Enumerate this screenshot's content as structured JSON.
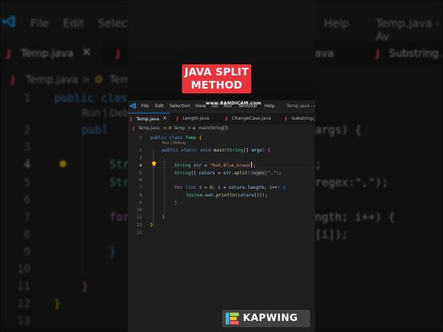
{
  "overlay": {
    "title_line1": "JAVA SPLIT",
    "title_line2": "METHOD",
    "bandicam": "www.BANDICAM.com",
    "watermark": "KAPWING",
    "title_color": "#e8333a"
  },
  "background": {
    "menu": [
      "File",
      "Edit",
      "Select",
      "Help"
    ],
    "window_title": "Temp.java - Av",
    "tabs": [
      "Temp.java",
      "ava",
      "Substring."
    ],
    "breadcrumb": [
      "Temp.java",
      "Tem"
    ],
    "line_numbers": [
      "1",
      "2",
      "3",
      "4",
      "5",
      "6",
      "7",
      "8",
      "9",
      "10",
      "11",
      "12",
      "13"
    ],
    "code_left": [
      "public clas",
      "Run | Deb",
      "publ",
      "Str",
      "Str",
      "for",
      "}",
      "}",
      "}"
    ],
    "code_right": [
      "args) {",
      ";",
      "regex:\",\");",
      "ngth; i++) {",
      "[i]);"
    ]
  },
  "editor": {
    "menu": [
      "File",
      "Edit",
      "Selection",
      "View",
      "Go",
      "Run",
      "Terminal",
      "Help"
    ],
    "window_title": "Temp.java - A",
    "tabs": [
      {
        "label": "Temp.java",
        "active": true
      },
      {
        "label": "Length.java",
        "active": false
      },
      {
        "label": "ChangeCase.java",
        "active": false
      },
      {
        "label": "Substring.j",
        "active": false
      }
    ],
    "breadcrumb": [
      "Temp.java",
      "Temp",
      "main(String[])"
    ],
    "codelens": "Run | Debug",
    "line_numbers": [
      "1",
      "2",
      "3",
      "4",
      "5",
      "6",
      "7",
      "8",
      "9",
      "10",
      "11",
      "12",
      "13"
    ],
    "current_line": 4,
    "parameter_hint": "regex:"
  }
}
